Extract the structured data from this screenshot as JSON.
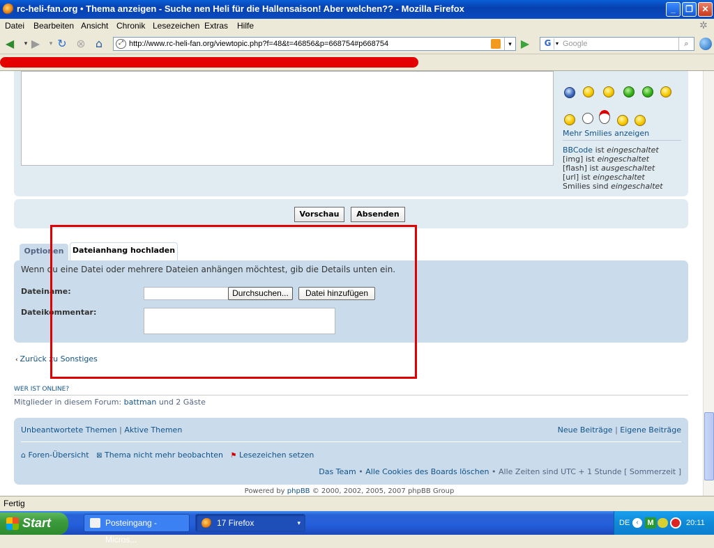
{
  "window": {
    "title": "rc-heli-fan.org • Thema anzeigen - Suche nen Heli für die Hallensaison! Aber welchen?? - Mozilla Firefox"
  },
  "menu": [
    "Datei",
    "Bearbeiten",
    "Ansicht",
    "Chronik",
    "Lesezeichen",
    "Extras",
    "Hilfe"
  ],
  "nav": {
    "url": "http://www.rc-heli-fan.org/viewtopic.php?f=48&t=46856&p=668754#p668754",
    "search_placeholder": "Google",
    "search_engine": "G"
  },
  "smilies": {
    "more_link": "Mehr Smilies anzeigen"
  },
  "bbcode": {
    "bb": "BBCode",
    "bb_state": "eingeschaltet",
    "img": "[img]",
    "img_state": "eingeschaltet",
    "flash": "[flash]",
    "flash_state": "ausgeschaltet",
    "url": "[url]",
    "url_state": "eingeschaltet",
    "smilies": "Smilies sind",
    "smilies_state": "eingeschaltet",
    "ist": "ist"
  },
  "buttons": {
    "preview": "Vorschau",
    "submit": "Absenden"
  },
  "tabs": {
    "options": "Optionen",
    "upload": "Dateianhang hochladen"
  },
  "upload": {
    "intro": "Wenn du eine Datei oder mehrere Dateien anhängen möchtest, gib die Details unten ein.",
    "filename_label": "Dateiname:",
    "browse_button": "Durchsuchen...",
    "add_button": "Datei hinzufügen",
    "comment_label": "Dateikommentar:"
  },
  "back_link": "Zurück zu Sonstiges",
  "online": {
    "heading": "WER IST ONLINE?",
    "prefix": "Mitglieder in diesem Forum: ",
    "user": "battman",
    "suffix": " und 2 Gäste"
  },
  "footer": {
    "unanswered": "Unbeantwortete Themen",
    "active": "Aktive Themen",
    "new_posts": "Neue Beiträge",
    "own_posts": "Eigene Beiträge",
    "sep": "|",
    "index": "Foren-Übersicht",
    "unwatch": "Thema nicht mehr beobachten",
    "bookmark": "Lesezeichen setzen",
    "team": "Das Team",
    "cookies": "Alle Cookies des Boards löschen",
    "bullet": "•",
    "timezone": "Alle Zeiten sind UTC + 1 Stunde [ Sommerzeit ]"
  },
  "powered": {
    "prefix": "Powered by ",
    "link": "phpBB",
    "suffix": " © 2000, 2002, 2005, 2007 phpBB Group"
  },
  "status": "Fertig",
  "taskbar": {
    "start": "Start",
    "task1": "Posteingang - Micros...",
    "task2": "17 Firefox",
    "lang": "DE",
    "clock": "20:11"
  },
  "colors": {
    "accent": "#105289",
    "panel": "#cadceb",
    "highlight": "#e00000"
  }
}
